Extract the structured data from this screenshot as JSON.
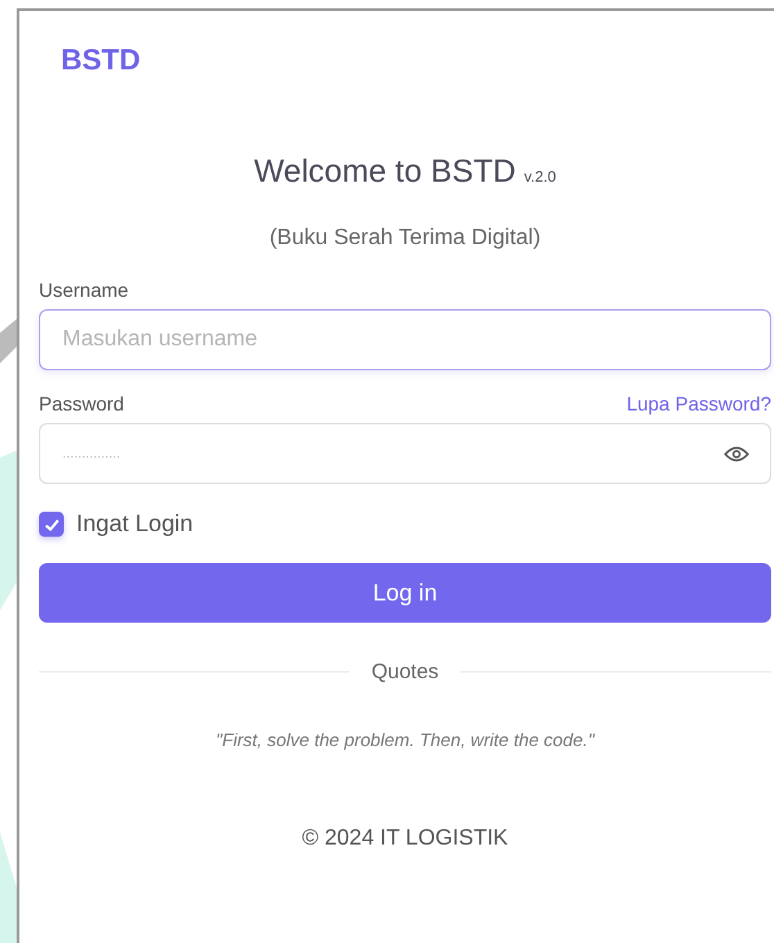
{
  "brand": "BSTD",
  "title": "Welcome to BSTD",
  "version": "v.2.0",
  "subtitle": "(Buku Serah Terima Digital)",
  "username": {
    "label": "Username",
    "placeholder": "Masukan username",
    "focused": true
  },
  "password": {
    "label": "Password",
    "link": "Lupa Password?",
    "placeholder": "..............."
  },
  "remember": {
    "label": "Ingat Login",
    "checked": true
  },
  "login_button": "Log in",
  "quotes": {
    "heading": "Quotes",
    "text": "\"First, solve the problem. Then, write the code.\""
  },
  "footer": "© 2024 IT LOGISTIK"
}
